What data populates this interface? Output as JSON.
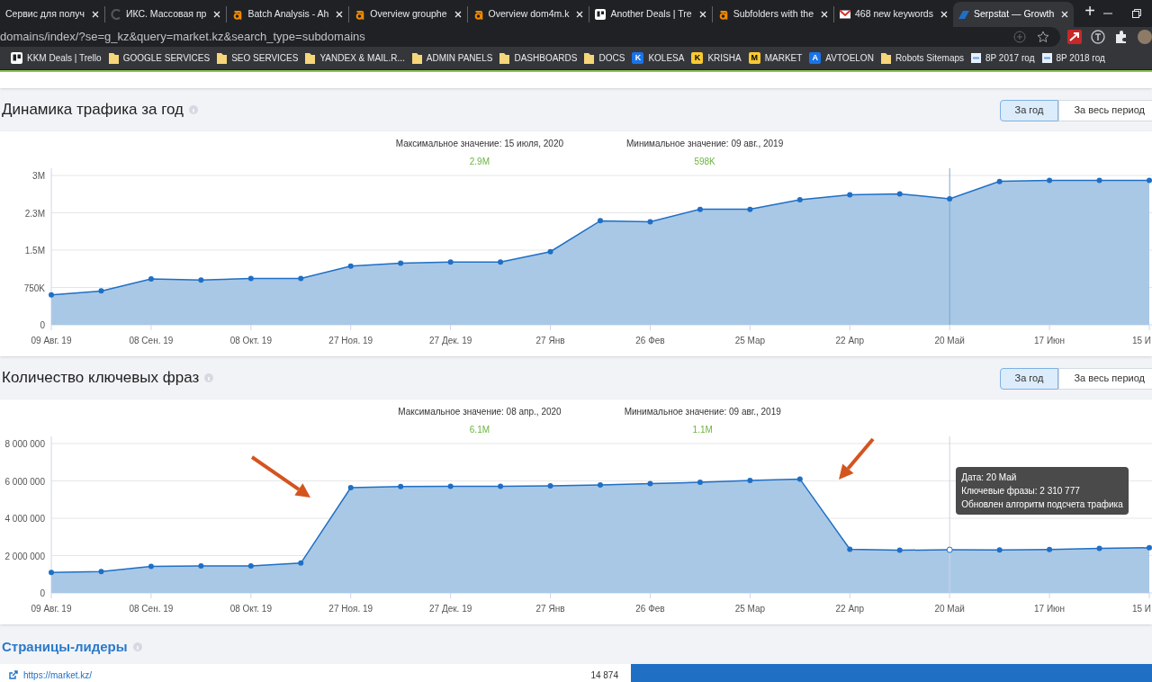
{
  "browser": {
    "tabs": [
      {
        "title": "Сервис для получ",
        "kind": "plain",
        "selected": false
      },
      {
        "title": "ИКС. Массовая пр",
        "kind": "c",
        "selected": false
      },
      {
        "title": "Batch Analysis - Ah",
        "kind": "a",
        "selected": false
      },
      {
        "title": "Overview grouphe",
        "kind": "a",
        "selected": false
      },
      {
        "title": "Overview dom4m.k",
        "kind": "a",
        "selected": false
      },
      {
        "title": "Another Deals | Tre",
        "kind": "board",
        "selected": false
      },
      {
        "title": "Subfolders with the",
        "kind": "a",
        "selected": false
      },
      {
        "title": "468 new keywords",
        "kind": "mail",
        "selected": false
      },
      {
        "title": "Serpstat — Growth",
        "kind": "site",
        "selected": true
      }
    ],
    "new_tab": "+",
    "address": "domains/index/?se=g_kz&query=market.kz&search_type=subdomains",
    "bookmarks": [
      {
        "label": "KKM Deals | Trello",
        "kind": "board"
      },
      {
        "label": "GOOGLE SERVICES",
        "kind": "folder"
      },
      {
        "label": "SEO SERVICES",
        "kind": "folder"
      },
      {
        "label": "YANDEX & MAIL.R...",
        "kind": "folder"
      },
      {
        "label": "ADMIN PANELS",
        "kind": "folder"
      },
      {
        "label": "DASHBOARDS",
        "kind": "folder"
      },
      {
        "label": "DOCS",
        "kind": "folder"
      },
      {
        "label": "KOLESA",
        "kind": "letter",
        "letter": "K",
        "color": "#1a73e8"
      },
      {
        "label": "KRISHA",
        "kind": "letter",
        "letter": "K",
        "color": "#f9c932"
      },
      {
        "label": "MARKET",
        "kind": "letter",
        "letter": "M",
        "color": "#f9c932"
      },
      {
        "label": "AVTOELON",
        "kind": "letter",
        "letter": "A",
        "color": "#1a73e8"
      },
      {
        "label": "Robots Sitemaps",
        "kind": "folder"
      },
      {
        "label": "8P 2017 год",
        "kind": "page"
      },
      {
        "label": "8P 2018 год",
        "kind": "page"
      }
    ]
  },
  "sections": [
    {
      "title": "Динамика трафика за год",
      "periods": [
        {
          "label": "За год",
          "selected": true
        },
        {
          "label": "За весь период",
          "selected": false
        }
      ],
      "max": {
        "label": "Максимальное значение: 15 июля, 2020",
        "value": "2.9M"
      },
      "min": {
        "label": "Минимальное значение: 09 авг., 2019",
        "value": "598K"
      },
      "chart_data": {
        "type": "area",
        "categories": [
          "09 Авг. 19",
          null,
          "08 Сен. 19",
          null,
          "08 Окт. 19",
          null,
          "27 Ноя. 19",
          null,
          "27 Дек. 19",
          null,
          "27 Янв",
          null,
          "26 Фев",
          null,
          "25 Мар",
          null,
          "22 Апр",
          null,
          "20 Май",
          null,
          "17 Июн",
          null,
          "15 И"
        ],
        "series": [
          {
            "color": "#1f6fc5",
            "values": [
              600000,
              680000,
              920000,
              900000,
              930000,
              930000,
              1180000,
              1240000,
              1260000,
              1260000,
              1470000,
              2090000,
              2070000,
              2320000,
              2320000,
              2510000,
              2610000,
              2630000,
              2530000,
              2880000,
              2900000,
              2900000,
              2900000
            ]
          }
        ],
        "grid": true,
        "ylim": [
          0,
          3000000
        ],
        "yticks": [
          {
            "value": 0,
            "label": "0"
          },
          {
            "value": 750000,
            "label": "750K"
          },
          {
            "value": 1500000,
            "label": "1.5M"
          },
          {
            "value": 2250000,
            "label": "2.3M"
          },
          {
            "value": 3000000,
            "label": "3M"
          }
        ],
        "ref_lines": [
          {
            "axis": "x",
            "value": "20 Май"
          }
        ]
      }
    },
    {
      "title": "Количество ключевых фраз",
      "periods": [
        {
          "label": "За год",
          "selected": true
        },
        {
          "label": "За весь период",
          "selected": false
        }
      ],
      "max": {
        "label": "Максимальное значение: 08 апр., 2020",
        "value": "6.1M"
      },
      "min": {
        "label": "Минимальное значение: 09 авг., 2019",
        "value": "1.1M"
      },
      "chart_data": {
        "type": "area",
        "categories": [
          "09 Авг. 19",
          null,
          "08 Сен. 19",
          null,
          "08 Окт. 19",
          null,
          "27 Ноя. 19",
          null,
          "27 Дек. 19",
          null,
          "27 Янв",
          null,
          "26 Фев",
          null,
          "25 Мар",
          null,
          "22 Апр",
          null,
          "20 Май",
          null,
          "17 Июн",
          null,
          "15 И"
        ],
        "series": [
          {
            "color": "#1f6fc5",
            "values": [
              1100000,
              1140000,
              1420000,
              1450000,
              1450000,
              1600000,
              5640000,
              5700000,
              5710000,
              5710000,
              5740000,
              5780000,
              5850000,
              5930000,
              6030000,
              6100000,
              2340000,
              2290000,
              2310000,
              2300000,
              2330000,
              2380000,
              2420000
            ]
          }
        ],
        "grid": true,
        "ylim": [
          0,
          8000000
        ],
        "yticks": [
          {
            "value": 0,
            "label": "0"
          },
          {
            "value": 2000000,
            "label": "2 000 000"
          },
          {
            "value": 4000000,
            "label": "4 000 000"
          },
          {
            "value": 6000000,
            "label": "6 000 000"
          },
          {
            "value": 8000000,
            "label": "8 000 000"
          }
        ],
        "ref_lines": [
          {
            "axis": "x",
            "value": "20 Май"
          }
        ],
        "annotations": [
          "Дата: 20 Май\nКлючевые фразы: 2 310 777\nОбновлен алгоритм подсчета трафика"
        ]
      }
    }
  ],
  "leaders": {
    "title": "Страницы-лидеры",
    "rows": [
      {
        "url": "https://market.kz/",
        "count": "14 874",
        "level": 1
      }
    ]
  }
}
